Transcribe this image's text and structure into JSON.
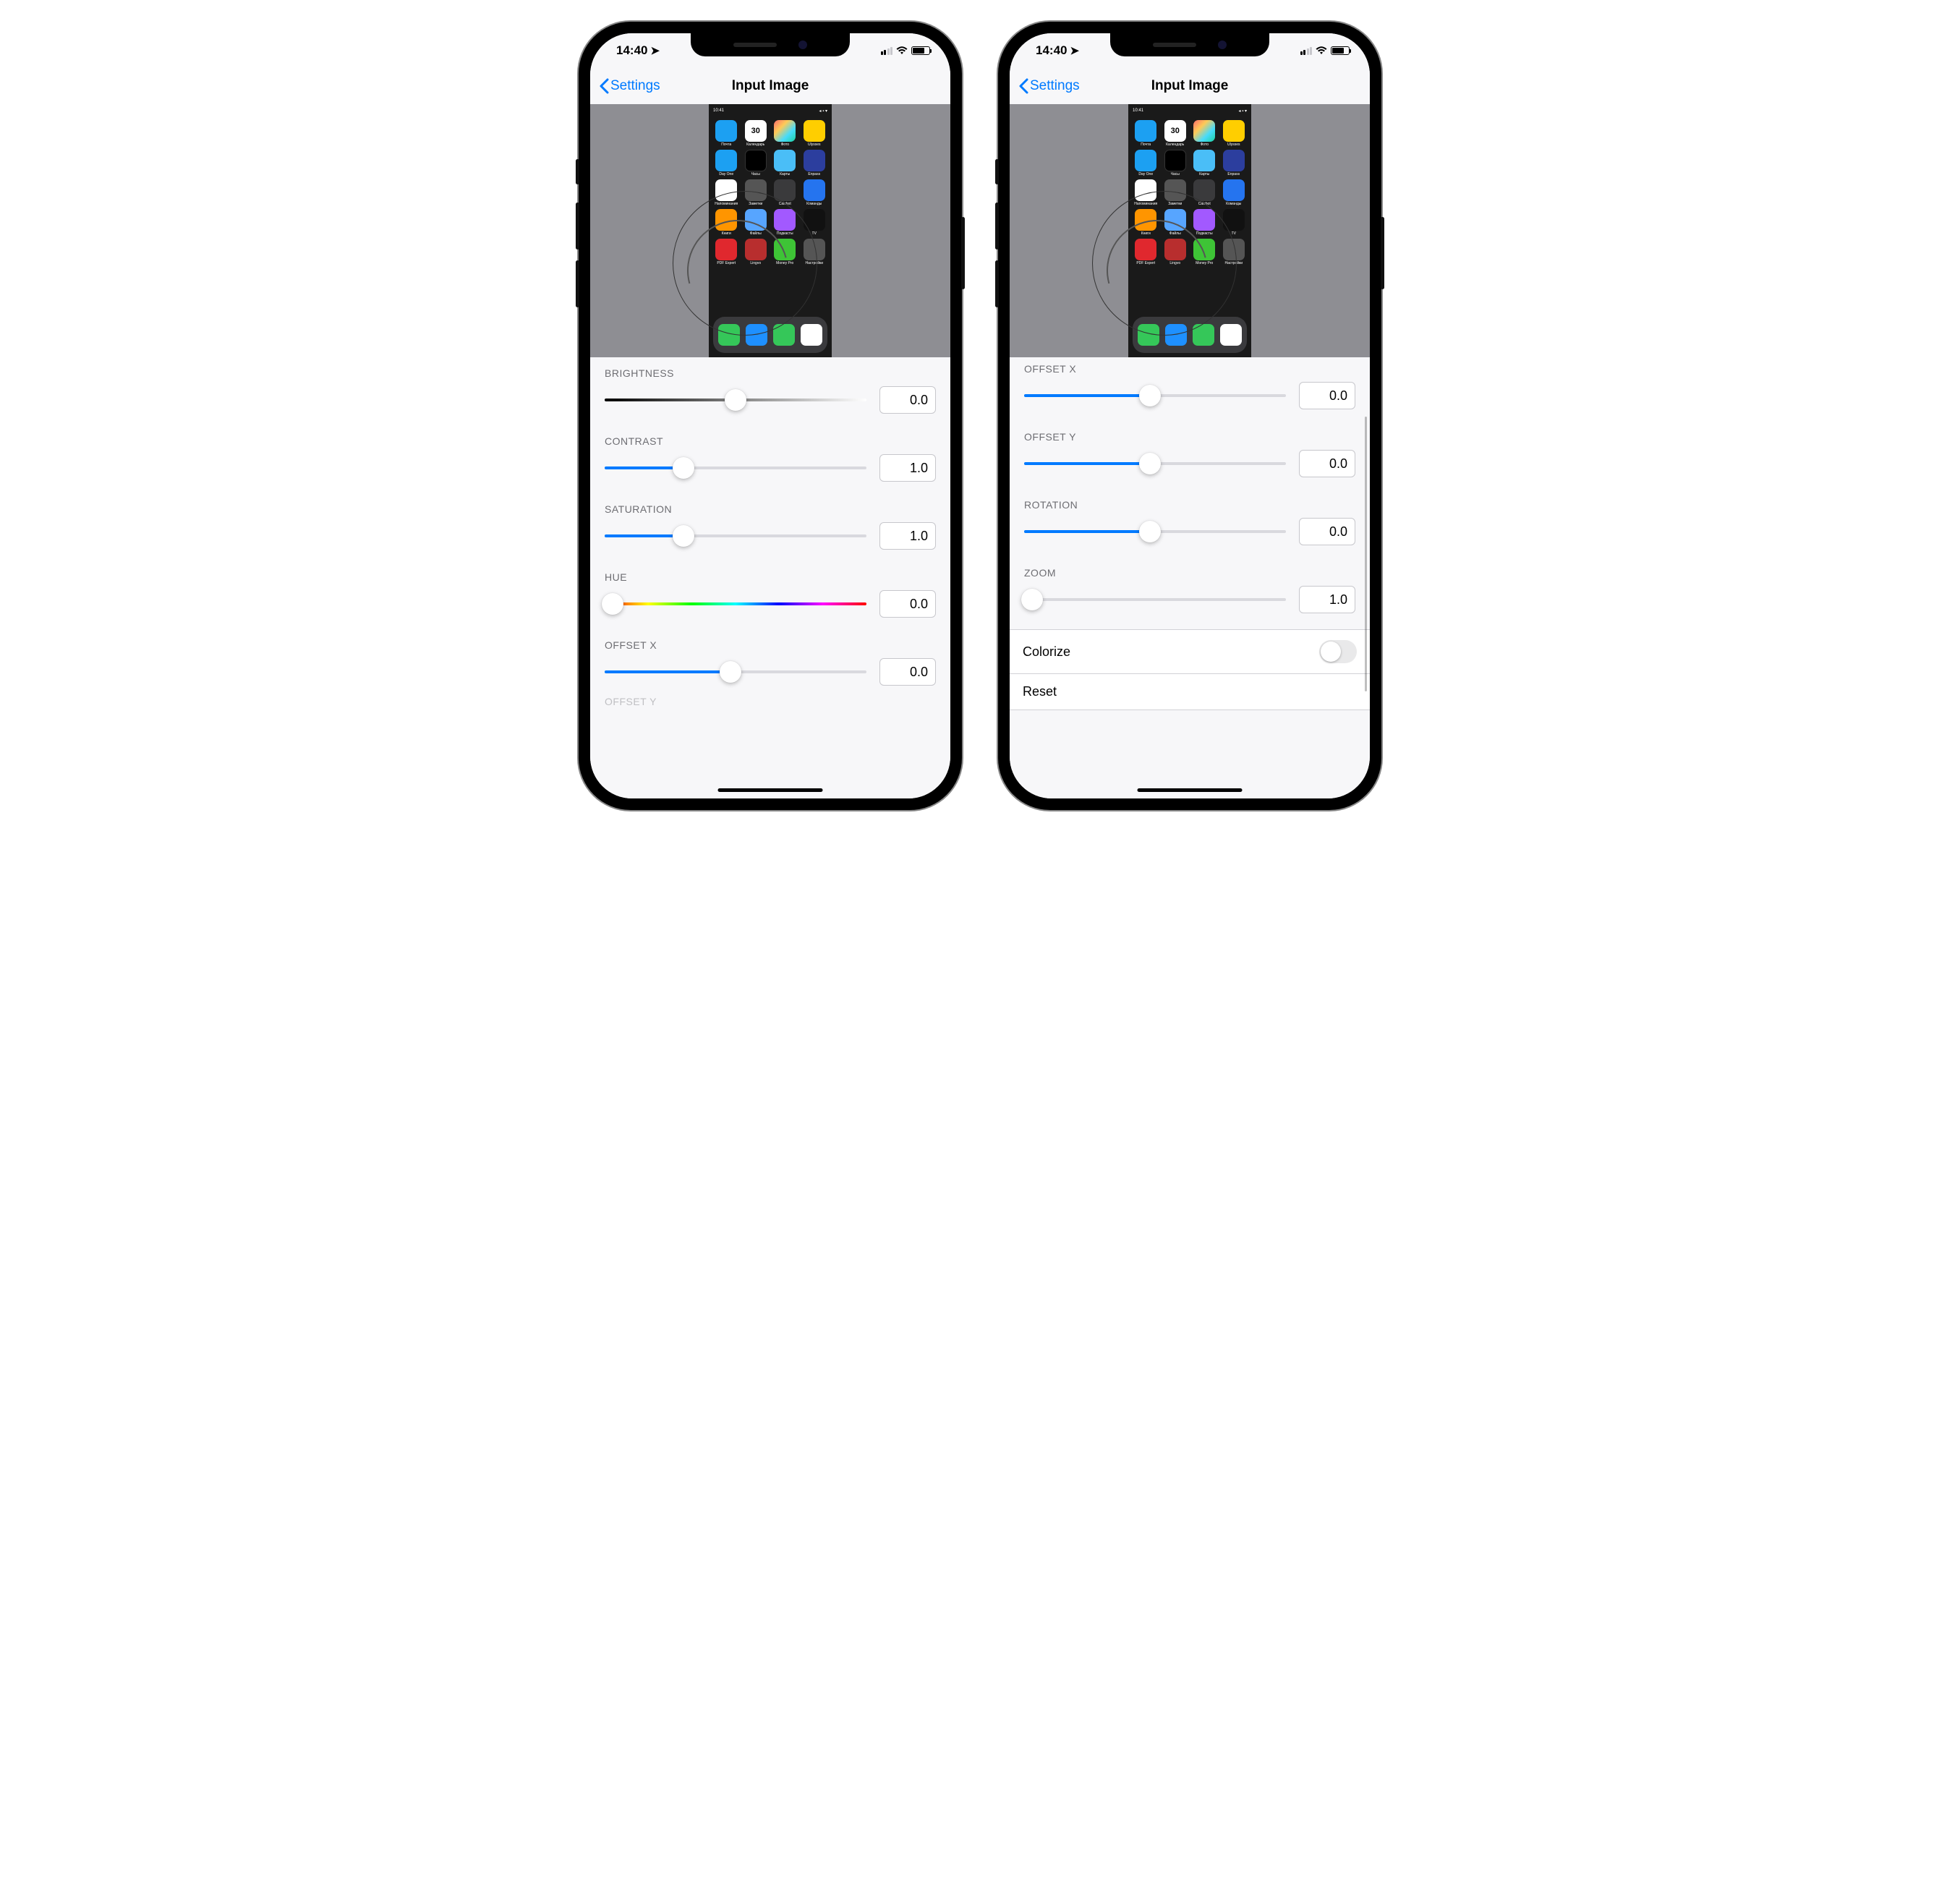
{
  "status": {
    "time": "14:40",
    "location_icon": "location-arrow"
  },
  "nav": {
    "back_label": "Settings",
    "title": "Input Image"
  },
  "preview": {
    "status_time": "10:41",
    "apps": [
      {
        "label": "Почта",
        "color": "c-blue"
      },
      {
        "label": "Календарь",
        "color": "c-white",
        "text": "30"
      },
      {
        "label": "Фото",
        "color": "c-photos"
      },
      {
        "label": "Ulysses",
        "color": "c-yellow"
      },
      {
        "label": "Day One",
        "color": "c-blue"
      },
      {
        "label": "Часы",
        "color": "c-clock"
      },
      {
        "label": "Карты",
        "color": "c-bluemap"
      },
      {
        "label": "Enpass",
        "color": "c-darkblue"
      },
      {
        "label": "Напоминания",
        "color": "c-whitedot"
      },
      {
        "label": "Заметки",
        "color": "c-gray"
      },
      {
        "label": "Calcbot",
        "color": "c-calc"
      },
      {
        "label": "Команды",
        "color": "c-bluesc"
      },
      {
        "label": "Книги",
        "color": "c-orange"
      },
      {
        "label": "Файлы",
        "color": "c-files"
      },
      {
        "label": "Подкасты",
        "color": "c-purple"
      },
      {
        "label": "TV",
        "color": "c-tv"
      },
      {
        "label": "PDF Expert",
        "color": "c-red"
      },
      {
        "label": "Lingvo",
        "color": "c-brown"
      },
      {
        "label": "Money Pro",
        "color": "c-green"
      },
      {
        "label": "Настройки",
        "color": "c-set"
      }
    ],
    "dock": [
      {
        "color": "c-phone"
      },
      {
        "color": "c-safari"
      },
      {
        "color": "c-msg"
      },
      {
        "color": "c-music"
      }
    ]
  },
  "left": {
    "brightness": {
      "label": "BRIGHTNESS",
      "value": "0.0",
      "pct": 50
    },
    "contrast": {
      "label": "CONTRAST",
      "value": "1.0",
      "pct": 30
    },
    "saturation": {
      "label": "SATURATION",
      "value": "1.0",
      "pct": 30
    },
    "hue": {
      "label": "HUE",
      "value": "0.0",
      "pct": 3
    },
    "offsetx": {
      "label": "OFFSET X",
      "value": "0.0",
      "pct": 48
    },
    "next_label": "OFFSET Y"
  },
  "right": {
    "offsetx": {
      "label": "OFFSET X",
      "value": "0.0",
      "pct": 48
    },
    "offsety": {
      "label": "OFFSET Y",
      "value": "0.0",
      "pct": 48
    },
    "rotation": {
      "label": "ROTATION",
      "value": "0.0",
      "pct": 48
    },
    "zoom": {
      "label": "ZOOM",
      "value": "1.0",
      "pct": 3
    },
    "colorize_label": "Colorize",
    "colorize_on": false,
    "reset_label": "Reset"
  }
}
